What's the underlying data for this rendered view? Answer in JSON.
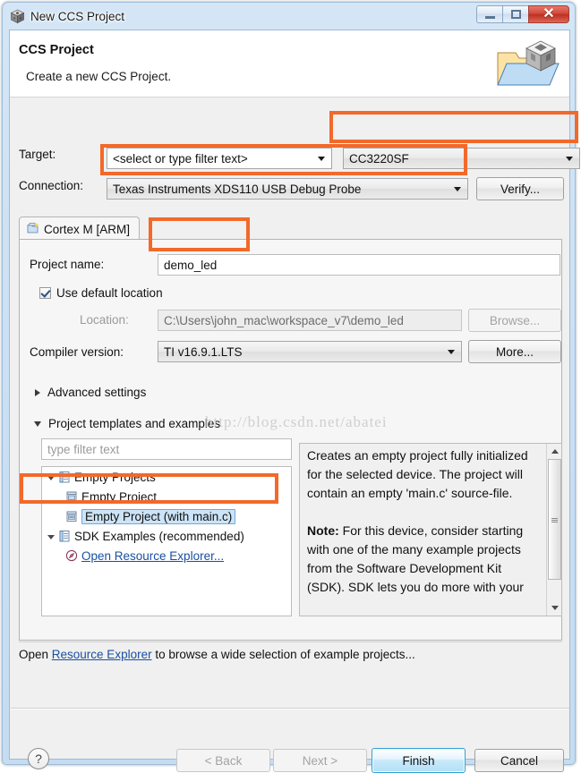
{
  "window": {
    "title": "New CCS Project",
    "icon": "ccs-cube-icon",
    "buttons": {
      "minimize": "minimize-icon",
      "maximize": "maximize-icon",
      "close": "close-icon"
    }
  },
  "header": {
    "title": "CCS Project",
    "subtitle": "Create a new CCS Project.",
    "icon": "project-folder-icon"
  },
  "target_row": {
    "label": "Target:",
    "filter_value": "<select or type filter text>",
    "device_value": "CC3220SF"
  },
  "connection_row": {
    "label": "Connection:",
    "value": "Texas Instruments XDS110 USB Debug Probe",
    "verify_button": "Verify..."
  },
  "tab": {
    "label": "Cortex M [ARM]",
    "icon": "project-tab-icon"
  },
  "project": {
    "name_label": "Project name:",
    "name_value": "demo_led",
    "use_default_location_label": "Use default location",
    "use_default_location_checked": true,
    "location_label": "Location:",
    "location_value": "C:\\Users\\john_mac\\workspace_v7\\demo_led",
    "browse_button": "Browse...",
    "compiler_label": "Compiler version:",
    "compiler_value": "TI v16.9.1.LTS",
    "more_button": "More..."
  },
  "sections": {
    "advanced_settings": "Advanced settings",
    "advanced_expanded": false,
    "project_templates": "Project templates and examples",
    "templates_expanded": true
  },
  "filter": {
    "placeholder": "type filter text",
    "value": ""
  },
  "tree": [
    {
      "label": "Empty Projects",
      "level": 1,
      "expanded": true,
      "icon": "folder-list-icon",
      "selected": false
    },
    {
      "label": "Empty Project",
      "level": 2,
      "icon": "project-item-icon",
      "selected": false
    },
    {
      "label": "Empty Project (with main.c)",
      "level": 2,
      "icon": "project-item-icon",
      "selected": true
    },
    {
      "label": "SDK Examples (recommended)",
      "level": 1,
      "expanded": true,
      "icon": "folder-list-icon",
      "selected": false
    },
    {
      "label": "Open Resource Explorer...",
      "level": 2,
      "icon": "compass-icon",
      "selected": false,
      "is_link": true
    }
  ],
  "description": {
    "paragraph1": "Creates an empty project fully initialized for the selected device. The project will contain an empty 'main.c' source-file.",
    "note_label": "Note:",
    "paragraph2": " For this device, consider starting with one of the many example projects from the Software Development Kit (SDK). SDK lets you do more with your",
    "scrollbar": "vertical-scrollbar"
  },
  "info_strip": {
    "prefix": "Open ",
    "link": "Resource Explorer",
    "suffix": " to browse a wide selection of example projects..."
  },
  "footer": {
    "help": "?",
    "back_button": "< Back",
    "next_button": "Next >",
    "finish_button": "Finish",
    "cancel_button": "Cancel"
  },
  "watermark": "http://blog.csdn.net/abatei",
  "colors": {
    "highlight": "#f2692a",
    "link": "#1a4fa0",
    "selection": "#cce4f7",
    "titlebar": "#cadff3"
  }
}
